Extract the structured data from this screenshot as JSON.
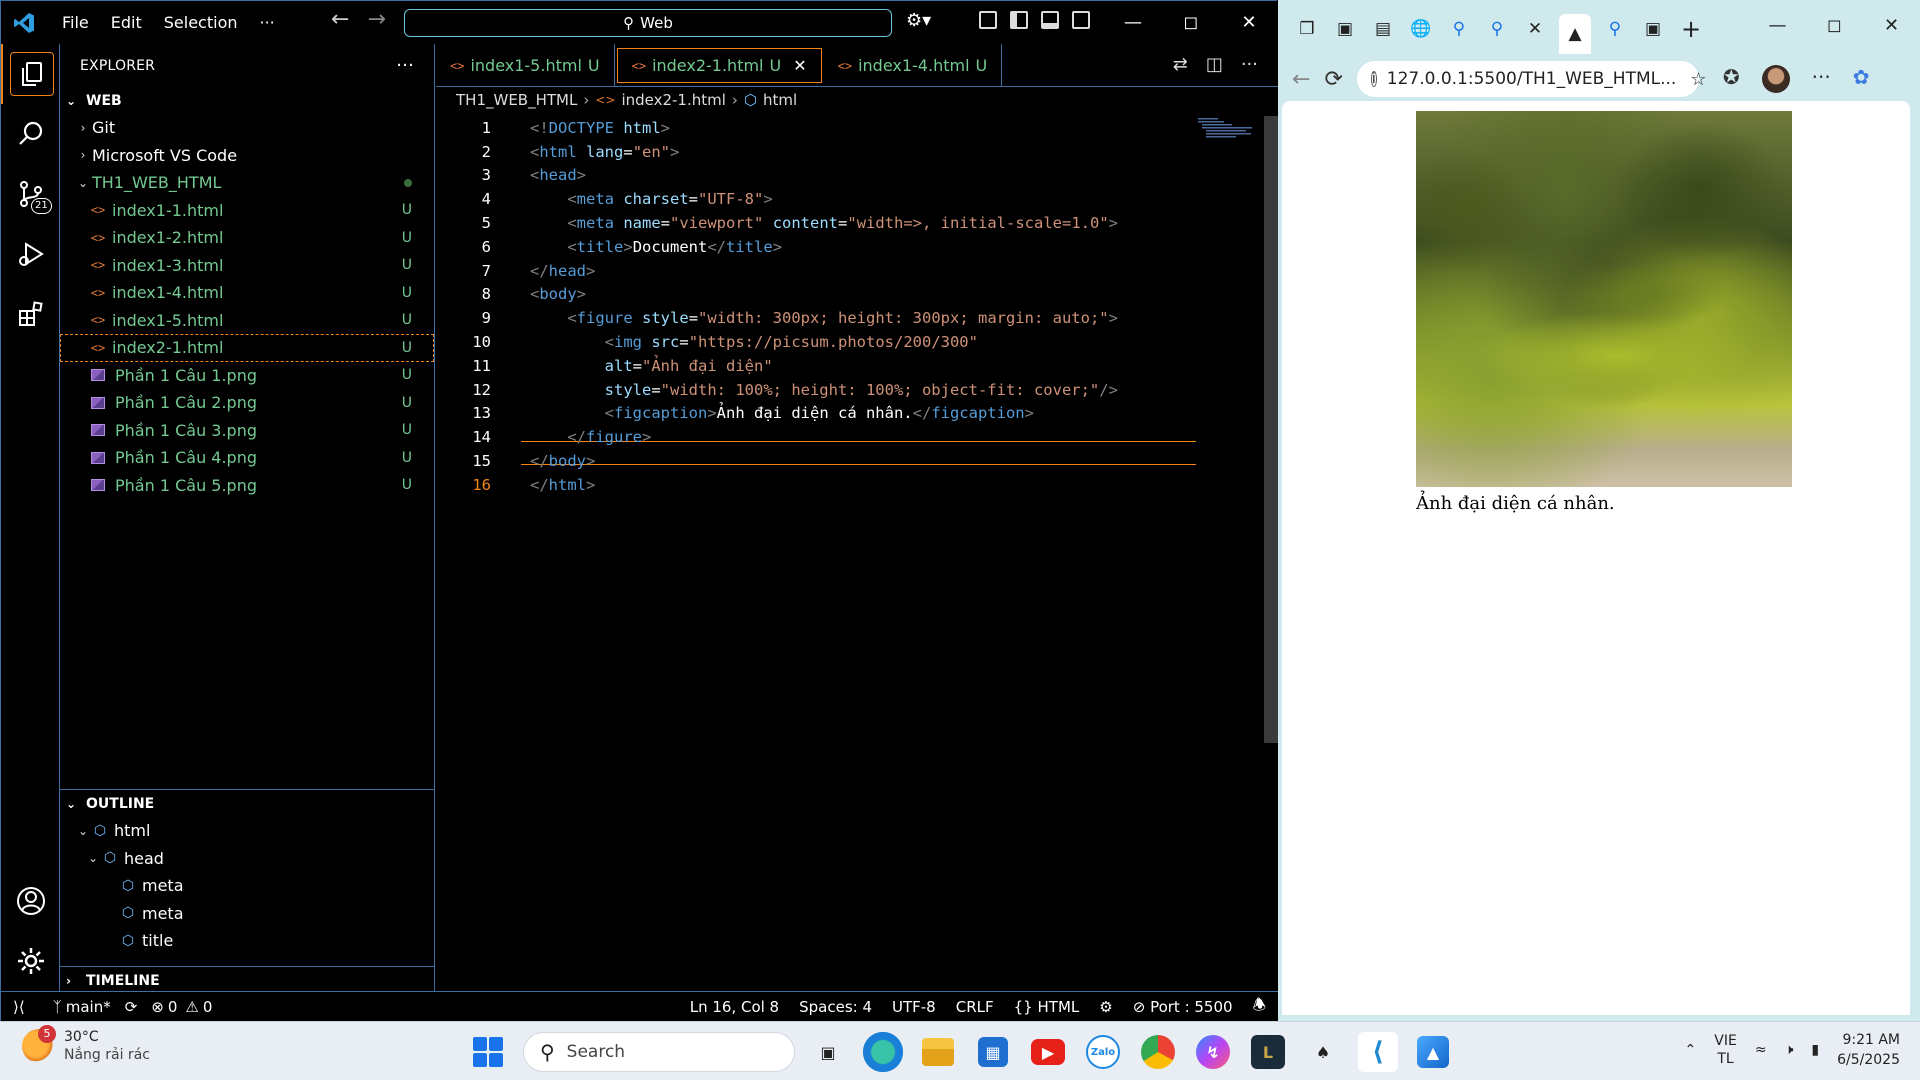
{
  "vscode": {
    "menu": [
      "File",
      "Edit",
      "Selection",
      "···"
    ],
    "search_label": "Web",
    "explorer_title": "EXPLORER",
    "explorer_more": "···",
    "workspace": "WEB",
    "folders": [
      "Git",
      "Microsoft VS Code"
    ],
    "project": "TH1_WEB_HTML",
    "files": [
      {
        "name": "index1-1.html",
        "status": "U"
      },
      {
        "name": "index1-2.html",
        "status": "U"
      },
      {
        "name": "index1-3.html",
        "status": "U"
      },
      {
        "name": "index1-4.html",
        "status": "U"
      },
      {
        "name": "index1-5.html",
        "status": "U"
      },
      {
        "name": "index2-1.html",
        "status": "U"
      },
      {
        "name": "Phần 1 Câu 1.png",
        "status": "U"
      },
      {
        "name": "Phần 1 Câu 2.png",
        "status": "U"
      },
      {
        "name": "Phần 1 Câu 3.png",
        "status": "U"
      },
      {
        "name": "Phần 1 Câu 4.png",
        "status": "U"
      },
      {
        "name": "Phần 1 Câu 5.png",
        "status": "U"
      }
    ],
    "outline_title": "OUTLINE",
    "outline": [
      "html",
      "head",
      "meta",
      "meta",
      "title"
    ],
    "timeline_title": "TIMELINE",
    "source_control_count": "21",
    "tabs": [
      {
        "name": "index1-5.html",
        "status": "U"
      },
      {
        "name": "index2-1.html",
        "status": "U"
      },
      {
        "name": "index1-4.html",
        "status": "U"
      }
    ],
    "breadcrumb": [
      "TH1_WEB_HTML",
      "index2-1.html",
      "html"
    ],
    "status": {
      "branch": "main*",
      "errors": "0",
      "warnings": "0",
      "position": "Ln 16, Col 8",
      "spaces": "Spaces: 4",
      "encoding": "UTF-8",
      "eol": "CRLF",
      "language": "HTML",
      "port": "Port : 5500"
    }
  },
  "code_lines": [
    {
      "n": "1",
      "parts": [
        [
          "g",
          "<!"
        ],
        [
          "t",
          "DOCTYPE"
        ],
        [
          "w",
          " "
        ],
        [
          "a",
          "html"
        ],
        [
          "g",
          ">"
        ]
      ]
    },
    {
      "n": "2",
      "parts": [
        [
          "g",
          "<"
        ],
        [
          "t",
          "html"
        ],
        [
          "w",
          " "
        ],
        [
          "a",
          "lang"
        ],
        [
          "w",
          "="
        ],
        [
          "s",
          "\"en\""
        ],
        [
          "g",
          ">"
        ]
      ]
    },
    {
      "n": "3",
      "parts": [
        [
          "g",
          "<"
        ],
        [
          "t",
          "head"
        ],
        [
          "g",
          ">"
        ]
      ]
    },
    {
      "n": "4",
      "parts": [
        [
          "w",
          "    "
        ],
        [
          "g",
          "<"
        ],
        [
          "t",
          "meta"
        ],
        [
          "w",
          " "
        ],
        [
          "a",
          "charset"
        ],
        [
          "w",
          "="
        ],
        [
          "s",
          "\"UTF-8\""
        ],
        [
          "g",
          ">"
        ]
      ]
    },
    {
      "n": "5",
      "parts": [
        [
          "w",
          "    "
        ],
        [
          "g",
          "<"
        ],
        [
          "t",
          "meta"
        ],
        [
          "w",
          " "
        ],
        [
          "a",
          "name"
        ],
        [
          "w",
          "="
        ],
        [
          "s",
          "\"viewport\""
        ],
        [
          "w",
          " "
        ],
        [
          "a",
          "content"
        ],
        [
          "w",
          "="
        ],
        [
          "s",
          "\"width=>, initial-scale=1.0\""
        ],
        [
          "g",
          ">"
        ]
      ]
    },
    {
      "n": "6",
      "parts": [
        [
          "w",
          "    "
        ],
        [
          "g",
          "<"
        ],
        [
          "t",
          "title"
        ],
        [
          "g",
          ">"
        ],
        [
          "w",
          "Document"
        ],
        [
          "g",
          "</"
        ],
        [
          "t",
          "title"
        ],
        [
          "g",
          ">"
        ]
      ]
    },
    {
      "n": "7",
      "parts": [
        [
          "g",
          "</"
        ],
        [
          "t",
          "head"
        ],
        [
          "g",
          ">"
        ]
      ]
    },
    {
      "n": "8",
      "parts": [
        [
          "g",
          "<"
        ],
        [
          "t",
          "body"
        ],
        [
          "g",
          ">"
        ]
      ]
    },
    {
      "n": "9",
      "parts": [
        [
          "w",
          "    "
        ],
        [
          "g",
          "<"
        ],
        [
          "t",
          "figure"
        ],
        [
          "w",
          " "
        ],
        [
          "a",
          "style"
        ],
        [
          "w",
          "="
        ],
        [
          "s",
          "\"width: 300px; height: 300px; margin: auto;\""
        ],
        [
          "g",
          ">"
        ]
      ]
    },
    {
      "n": "10",
      "parts": [
        [
          "w",
          "        "
        ],
        [
          "g",
          "<"
        ],
        [
          "t",
          "img"
        ],
        [
          "w",
          " "
        ],
        [
          "a",
          "src"
        ],
        [
          "w",
          "="
        ],
        [
          "s",
          "\"https://picsum.photos/200/300\""
        ]
      ]
    },
    {
      "n": "11",
      "parts": [
        [
          "w",
          "        "
        ],
        [
          "a",
          "alt"
        ],
        [
          "w",
          "="
        ],
        [
          "s",
          "\"Ảnh đại diện\""
        ]
      ]
    },
    {
      "n": "12",
      "parts": [
        [
          "w",
          "        "
        ],
        [
          "a",
          "style"
        ],
        [
          "w",
          "="
        ],
        [
          "s",
          "\"width: 100%; height: 100%; object-fit: cover;\""
        ],
        [
          "g",
          "/>"
        ]
      ]
    },
    {
      "n": "13",
      "parts": [
        [
          "w",
          "        "
        ],
        [
          "g",
          "<"
        ],
        [
          "t",
          "figcaption"
        ],
        [
          "g",
          ">"
        ],
        [
          "w",
          "Ảnh đại diện cá nhân."
        ],
        [
          "g",
          "</"
        ],
        [
          "t",
          "figcaption"
        ],
        [
          "g",
          ">"
        ]
      ]
    },
    {
      "n": "14",
      "parts": [
        [
          "w",
          "    "
        ],
        [
          "g",
          "</"
        ],
        [
          "t",
          "figure"
        ],
        [
          "g",
          ">"
        ]
      ]
    },
    {
      "n": "15",
      "parts": [
        [
          "g",
          "</"
        ],
        [
          "t",
          "body"
        ],
        [
          "g",
          ">"
        ]
      ]
    },
    {
      "n": "16",
      "parts": [
        [
          "g",
          "</"
        ],
        [
          "t",
          "html"
        ],
        [
          "g",
          ">"
        ]
      ]
    }
  ],
  "browser": {
    "url": "127.0.0.1:5500/TH1_WEB_HTML...",
    "caption": "Ảnh đại diện cá nhân."
  },
  "taskbar": {
    "weather_temp": "30°C",
    "weather_desc": "Nắng rải rác",
    "weather_badge": "5",
    "search": "Search",
    "lang_top": "VIE",
    "lang_bottom": "TL",
    "time": "9:21 AM",
    "date": "6/5/2025"
  }
}
